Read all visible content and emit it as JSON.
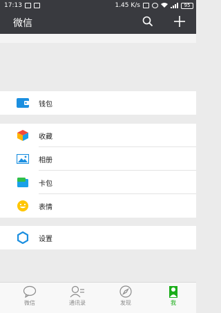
{
  "status_bar": {
    "time": "17:13",
    "speed": "1.45 K/s",
    "battery": "95"
  },
  "header": {
    "title": "微信",
    "search_icon": "search-icon",
    "add_icon": "plus-icon"
  },
  "menu": {
    "wallet": {
      "label": "钱包",
      "icon": "wallet-icon"
    },
    "favorites": {
      "label": "收藏",
      "icon": "favorites-cube-icon"
    },
    "album": {
      "label": "相册",
      "icon": "album-picture-icon"
    },
    "cards": {
      "label": "卡包",
      "icon": "card-icon"
    },
    "stickers": {
      "label": "表情",
      "icon": "smiley-icon"
    },
    "settings": {
      "label": "设置",
      "icon": "gear-icon"
    }
  },
  "tabbar": {
    "tabs": [
      {
        "label": "微信",
        "icon": "chat-bubble-icon",
        "active": false
      },
      {
        "label": "通讯录",
        "icon": "contacts-icon",
        "active": false
      },
      {
        "label": "发现",
        "icon": "compass-icon",
        "active": false
      },
      {
        "label": "我",
        "icon": "person-icon",
        "active": true
      }
    ]
  },
  "colors": {
    "header_bg": "#393a3f",
    "page_bg": "#ebebeb",
    "accent_green": "#1aad19",
    "wallet_blue": "#1b8fe0",
    "tab_inactive": "#8a8a8a"
  }
}
